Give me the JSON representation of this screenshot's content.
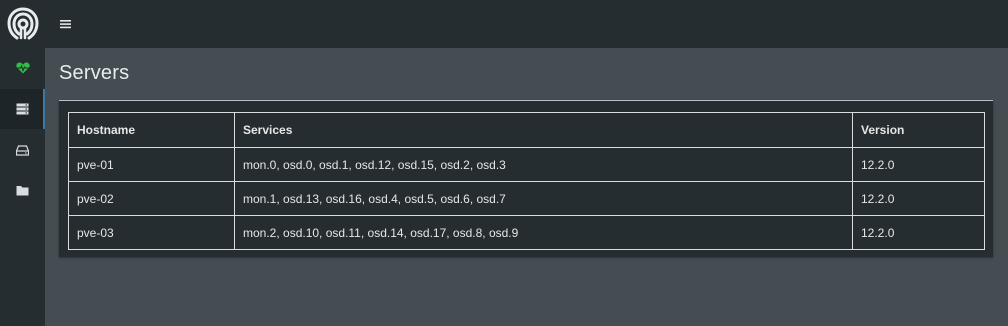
{
  "app": {
    "logo_icon": "ceph-logo-icon",
    "accent_color": "#3a7aa8",
    "health_color": "#2fbf45"
  },
  "sidebar": {
    "items": [
      {
        "icon": "heartbeat-icon",
        "active": false
      },
      {
        "icon": "server-list-icon",
        "active": true
      },
      {
        "icon": "drive-icon",
        "active": false
      },
      {
        "icon": "folder-icon",
        "active": false
      }
    ]
  },
  "topbar": {
    "menu_icon": "hamburger-menu-icon"
  },
  "page": {
    "title": "Servers"
  },
  "table": {
    "columns": [
      "Hostname",
      "Services",
      "Version"
    ],
    "rows": [
      {
        "hostname": "pve-01",
        "services": "mon.0, osd.0, osd.1, osd.12, osd.15, osd.2, osd.3",
        "version": "12.2.0"
      },
      {
        "hostname": "pve-02",
        "services": "mon.1, osd.13, osd.16, osd.4, osd.5, osd.6, osd.7",
        "version": "12.2.0"
      },
      {
        "hostname": "pve-03",
        "services": "mon.2, osd.10, osd.11, osd.14, osd.17, osd.8, osd.9",
        "version": "12.2.0"
      }
    ]
  }
}
